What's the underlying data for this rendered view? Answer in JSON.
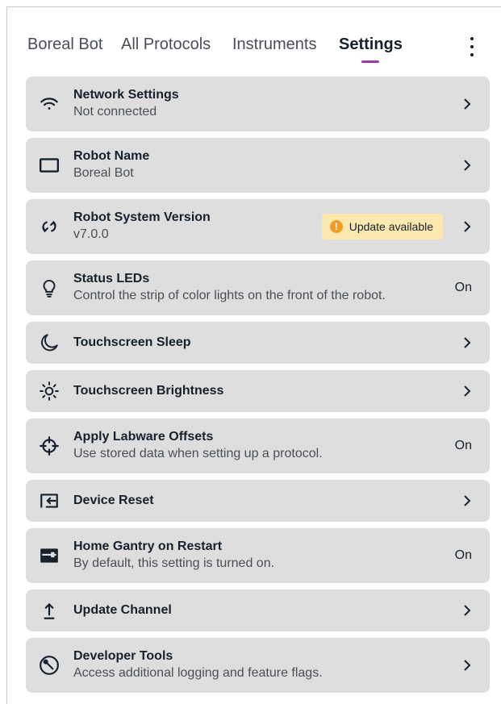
{
  "nav": {
    "tabs": [
      {
        "label": "Boreal Bot"
      },
      {
        "label": "All Protocols"
      },
      {
        "label": "Instruments"
      },
      {
        "label": "Settings",
        "active": true
      }
    ]
  },
  "settings": [
    {
      "title": "Network Settings",
      "subtitle": "Not connected",
      "icon": "wifi-icon",
      "action": "chevron"
    },
    {
      "title": "Robot Name",
      "subtitle": "Boreal Bot",
      "icon": "monitor-icon",
      "action": "chevron"
    },
    {
      "title": "Robot System Version",
      "subtitle": "v7.0.0",
      "icon": "sync-icon",
      "action": "chevron",
      "badge": "Update available"
    },
    {
      "title": "Status LEDs",
      "subtitle": "Control the strip of color lights on the front of the robot.",
      "icon": "lightbulb-icon",
      "action": "On"
    },
    {
      "title": "Touchscreen Sleep",
      "icon": "moon-icon",
      "action": "chevron"
    },
    {
      "title": "Touchscreen Brightness",
      "icon": "brightness-icon",
      "action": "chevron"
    },
    {
      "title": "Apply Labware Offsets",
      "subtitle": "Use stored data when setting up a protocol.",
      "icon": "crosshair-icon",
      "action": "On"
    },
    {
      "title": "Device Reset",
      "icon": "reset-icon",
      "action": "chevron"
    },
    {
      "title": "Home Gantry on Restart",
      "subtitle": "By default, this setting is turned on.",
      "icon": "gantry-icon",
      "action": "On"
    },
    {
      "title": "Update Channel",
      "icon": "upload-icon",
      "action": "chevron"
    },
    {
      "title": "Developer Tools",
      "subtitle": "Access additional logging and feature flags.",
      "icon": "wrench-icon",
      "action": "chevron"
    }
  ],
  "colors": {
    "accent": "#9c3ba4",
    "row_bg": "#dedede",
    "badge_bg": "#fde8b0",
    "warning": "#f09d24"
  }
}
